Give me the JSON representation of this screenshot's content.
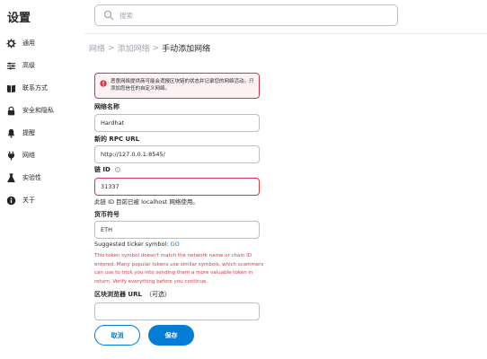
{
  "sidebar": {
    "title": "设置",
    "items": [
      {
        "label": "通用",
        "icon": "gear-icon"
      },
      {
        "label": "高级",
        "icon": "sliders-icon"
      },
      {
        "label": "联系方式",
        "icon": "contacts-book-icon"
      },
      {
        "label": "安全和隐私",
        "icon": "lock-icon"
      },
      {
        "label": "提醒",
        "icon": "bell-icon"
      },
      {
        "label": "网络",
        "icon": "plug-icon"
      },
      {
        "label": "实验性",
        "icon": "flask-icon"
      },
      {
        "label": "关于",
        "icon": "info-circle-icon"
      }
    ]
  },
  "search": {
    "placeholder": "搜索"
  },
  "breadcrumb": {
    "items": [
      "网络",
      "添加网络"
    ],
    "separator": ">",
    "current": "手动添加网络"
  },
  "warning": {
    "text": "恶意网络提供商可能会谎报区块链的状态并记录您的网络活动。只添加您信任的自定义网络。"
  },
  "form": {
    "network_name": {
      "label": "网络名称",
      "value": "Hardhat"
    },
    "rpc_url": {
      "label": "新的 RPC URL",
      "value": "http://127.0.0.1:8545/"
    },
    "chain_id": {
      "label": "链 ID",
      "value": "31337",
      "hint": "此链 ID 目前已被 localhost 网络使用。"
    },
    "currency_symbol": {
      "label": "货币符号",
      "value": "ETH"
    },
    "ticker": {
      "suggested_prefix": "Suggested ticker symbol:",
      "suggested_value": "GO",
      "warning": "This token symbol doesn't match the network name or chain ID entered. Many popular tokens use similar symbols, which scammers can use to trick you into sending them a more valuable token in return. Verify everything before you continue."
    },
    "block_explorer": {
      "label": "区块浏览器 URL",
      "optional": "（可选）",
      "value": ""
    }
  },
  "buttons": {
    "cancel": "取消",
    "save": "保存"
  },
  "colors": {
    "accent": "#037dd6",
    "error": "#d73847",
    "warning_bg": "#fcf2f3",
    "text": "#24272a",
    "muted": "#9fa6ae"
  }
}
